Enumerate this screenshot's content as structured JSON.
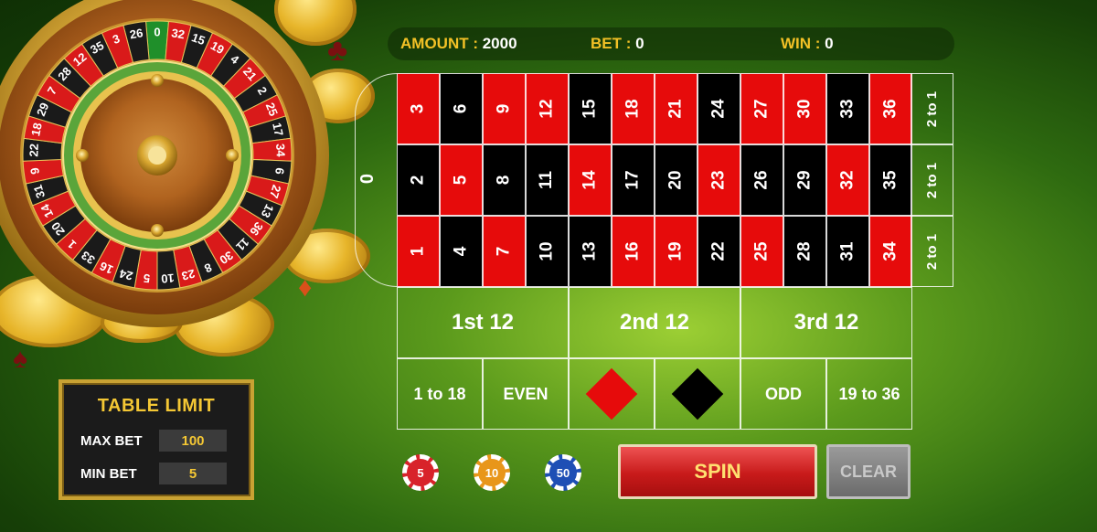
{
  "wheel": {
    "numbers": [
      "0",
      "32",
      "15",
      "19",
      "4",
      "21",
      "2",
      "25",
      "17",
      "34",
      "6",
      "27",
      "13",
      "36",
      "11",
      "30",
      "8",
      "23",
      "10",
      "5",
      "24",
      "16",
      "33",
      "1",
      "20",
      "14",
      "31",
      "9",
      "22",
      "18",
      "29",
      "7",
      "28",
      "12",
      "35",
      "3",
      "26"
    ]
  },
  "status": {
    "amount_label": "AMOUNT :",
    "amount_value": "2000",
    "bet_label": "BET :",
    "bet_value": "0",
    "win_label": "WIN :",
    "win_value": "0"
  },
  "board": {
    "zero": "0",
    "rows": [
      [
        {
          "n": "3",
          "c": "red"
        },
        {
          "n": "6",
          "c": "black"
        },
        {
          "n": "9",
          "c": "red"
        },
        {
          "n": "12",
          "c": "red"
        },
        {
          "n": "15",
          "c": "black"
        },
        {
          "n": "18",
          "c": "red"
        },
        {
          "n": "21",
          "c": "red"
        },
        {
          "n": "24",
          "c": "black"
        },
        {
          "n": "27",
          "c": "red"
        },
        {
          "n": "30",
          "c": "red"
        },
        {
          "n": "33",
          "c": "black"
        },
        {
          "n": "36",
          "c": "red"
        }
      ],
      [
        {
          "n": "2",
          "c": "black"
        },
        {
          "n": "5",
          "c": "red"
        },
        {
          "n": "8",
          "c": "black"
        },
        {
          "n": "11",
          "c": "black"
        },
        {
          "n": "14",
          "c": "red"
        },
        {
          "n": "17",
          "c": "black"
        },
        {
          "n": "20",
          "c": "black"
        },
        {
          "n": "23",
          "c": "red"
        },
        {
          "n": "26",
          "c": "black"
        },
        {
          "n": "29",
          "c": "black"
        },
        {
          "n": "32",
          "c": "red"
        },
        {
          "n": "35",
          "c": "black"
        }
      ],
      [
        {
          "n": "1",
          "c": "red"
        },
        {
          "n": "4",
          "c": "black"
        },
        {
          "n": "7",
          "c": "red"
        },
        {
          "n": "10",
          "c": "black"
        },
        {
          "n": "13",
          "c": "black"
        },
        {
          "n": "16",
          "c": "red"
        },
        {
          "n": "19",
          "c": "red"
        },
        {
          "n": "22",
          "c": "black"
        },
        {
          "n": "25",
          "c": "red"
        },
        {
          "n": "28",
          "c": "black"
        },
        {
          "n": "31",
          "c": "black"
        },
        {
          "n": "34",
          "c": "red"
        }
      ]
    ],
    "column_bets": [
      "2 to 1",
      "2 to 1",
      "2 to 1"
    ],
    "dozens": [
      "1st 12",
      "2nd 12",
      "3rd 12"
    ],
    "outside": [
      "1 to 18",
      "EVEN",
      "red",
      "black",
      "ODD",
      "19 to 36"
    ],
    "colors": {
      "red": "#e60b0b",
      "black": "#000000"
    }
  },
  "table_limit": {
    "title": "TABLE LIMIT",
    "max_bet_label": "MAX BET",
    "max_bet_value": "100",
    "min_bet_label": "MIN BET",
    "min_bet_value": "5"
  },
  "chips": [
    {
      "value": "5",
      "color": "#d8232a"
    },
    {
      "value": "10",
      "color": "#e8961a"
    },
    {
      "value": "50",
      "color": "#1e4fb5"
    }
  ],
  "buttons": {
    "spin": "SPIN",
    "clear": "CLEAR"
  }
}
